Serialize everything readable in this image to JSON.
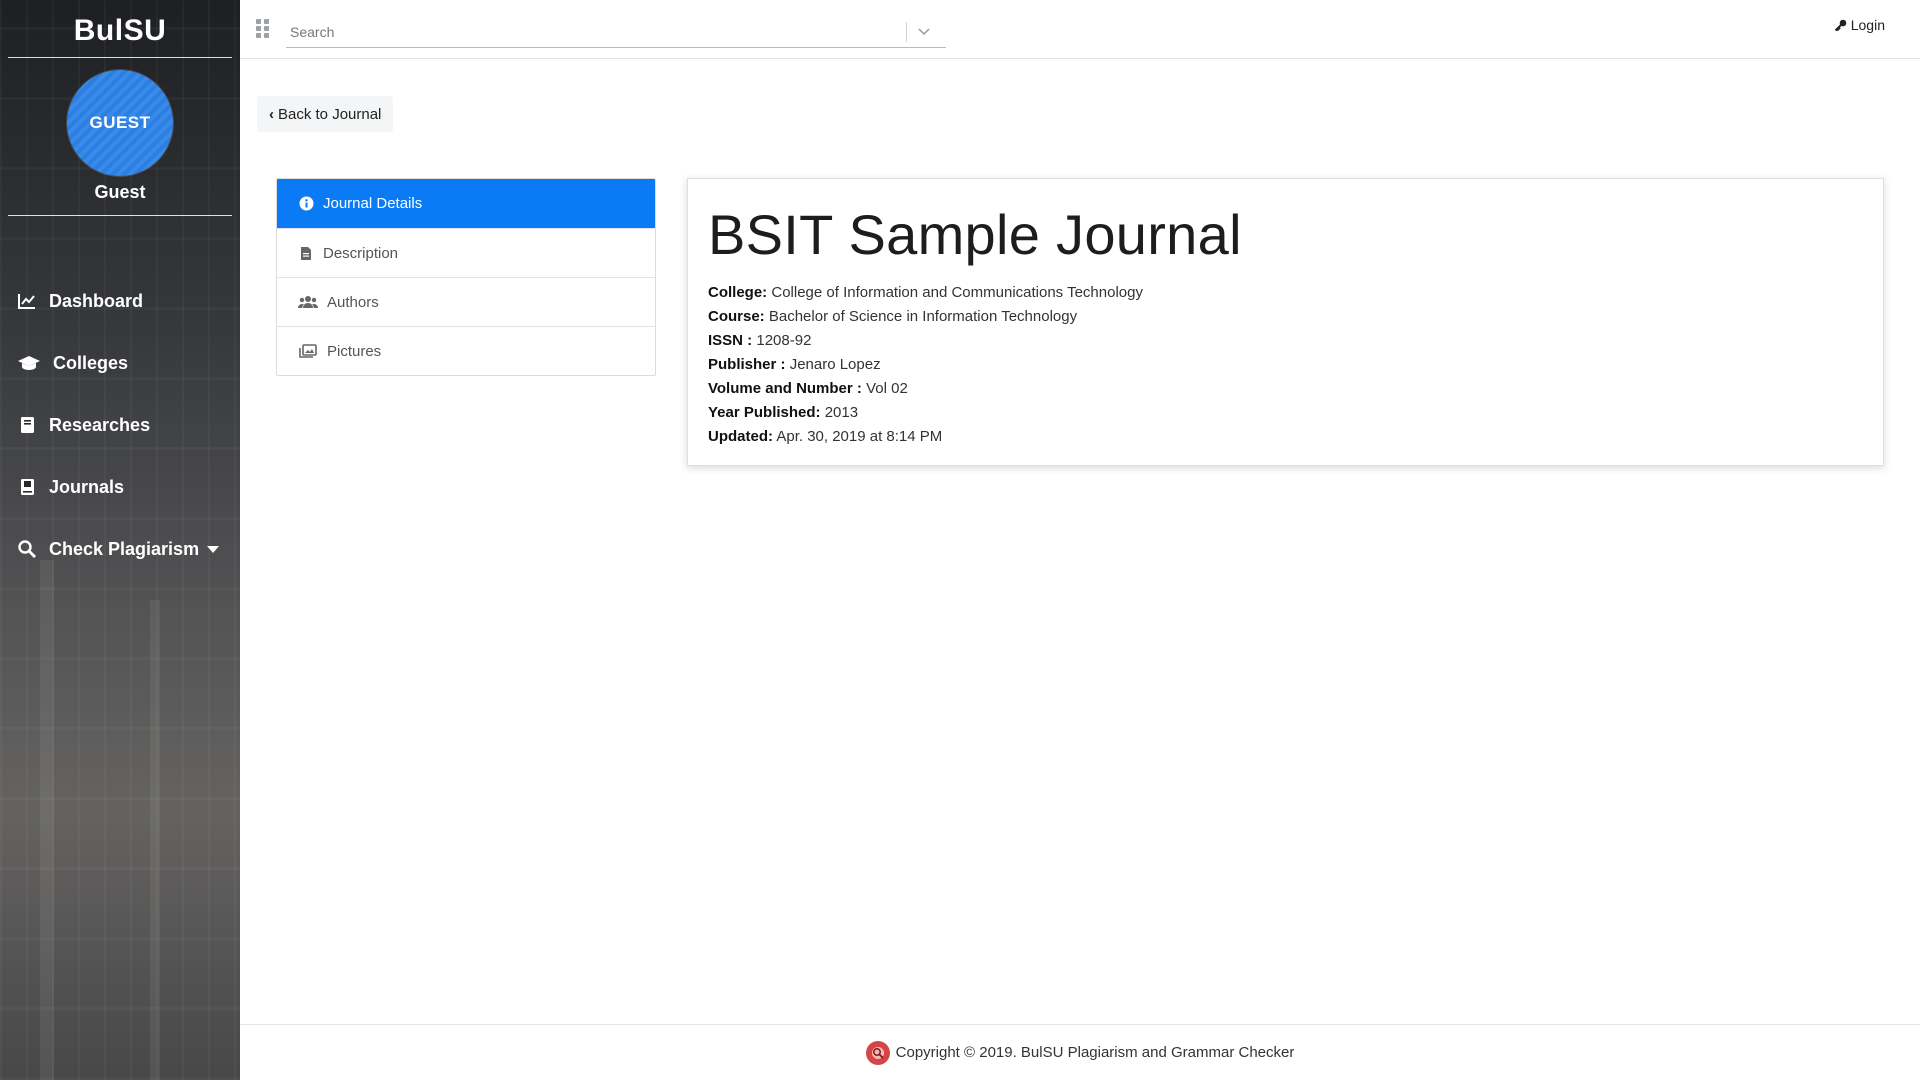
{
  "sidebar": {
    "brand": "BulSU",
    "avatar_text": "GUEST",
    "user_name": "Guest",
    "items": [
      {
        "label": "Dashboard",
        "icon": "chart-line-icon"
      },
      {
        "label": "Colleges",
        "icon": "graduation-cap-icon"
      },
      {
        "label": "Researches",
        "icon": "book-icon"
      },
      {
        "label": "Journals",
        "icon": "journal-icon"
      },
      {
        "label": "Check Plagiarism",
        "icon": "search-icon",
        "has_dropdown": true
      }
    ]
  },
  "topbar": {
    "search_placeholder": "Search",
    "login_label": "Login"
  },
  "main": {
    "back_label": "Back to Journal",
    "tabs": [
      {
        "label": "Journal Details",
        "icon": "info-circle-icon",
        "active": true
      },
      {
        "label": "Description",
        "icon": "file-icon",
        "active": false
      },
      {
        "label": "Authors",
        "icon": "users-icon",
        "active": false
      },
      {
        "label": "Pictures",
        "icon": "images-icon",
        "active": false
      }
    ],
    "journal": {
      "title": "BSIT Sample Journal",
      "fields": [
        {
          "label": "College:",
          "value": "College of Information and Communications Technology"
        },
        {
          "label": "Course:",
          "value": "Bachelor of Science in Information Technology"
        },
        {
          "label": "ISSN :",
          "value": "1208-92"
        },
        {
          "label": "Publisher :",
          "value": "Jenaro Lopez"
        },
        {
          "label": "Volume and Number :",
          "value": "Vol 02"
        },
        {
          "label": "Year Published:",
          "value": "2013"
        },
        {
          "label": "Updated:",
          "value": "Apr. 30, 2019 at 8:14 PM"
        }
      ]
    }
  },
  "footer": {
    "text": "Copyright © 2019. BulSU Plagiarism and Grammar Checker"
  },
  "colors": {
    "accent": "#0a7bf4",
    "avatar": "#2b7fe0"
  }
}
